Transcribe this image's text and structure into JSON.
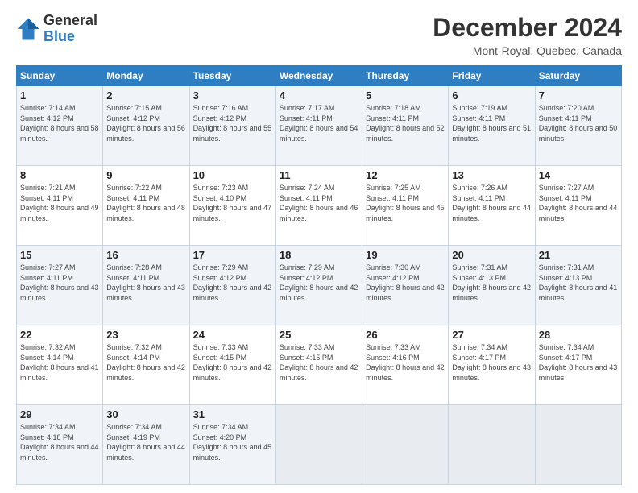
{
  "header": {
    "logo_general": "General",
    "logo_blue": "Blue",
    "month_title": "December 2024",
    "location": "Mont-Royal, Quebec, Canada"
  },
  "weekdays": [
    "Sunday",
    "Monday",
    "Tuesday",
    "Wednesday",
    "Thursday",
    "Friday",
    "Saturday"
  ],
  "weeks": [
    [
      {
        "day": "1",
        "sunrise": "7:14 AM",
        "sunset": "4:12 PM",
        "daylight": "8 hours and 58 minutes."
      },
      {
        "day": "2",
        "sunrise": "7:15 AM",
        "sunset": "4:12 PM",
        "daylight": "8 hours and 56 minutes."
      },
      {
        "day": "3",
        "sunrise": "7:16 AM",
        "sunset": "4:12 PM",
        "daylight": "8 hours and 55 minutes."
      },
      {
        "day": "4",
        "sunrise": "7:17 AM",
        "sunset": "4:11 PM",
        "daylight": "8 hours and 54 minutes."
      },
      {
        "day": "5",
        "sunrise": "7:18 AM",
        "sunset": "4:11 PM",
        "daylight": "8 hours and 52 minutes."
      },
      {
        "day": "6",
        "sunrise": "7:19 AM",
        "sunset": "4:11 PM",
        "daylight": "8 hours and 51 minutes."
      },
      {
        "day": "7",
        "sunrise": "7:20 AM",
        "sunset": "4:11 PM",
        "daylight": "8 hours and 50 minutes."
      }
    ],
    [
      {
        "day": "8",
        "sunrise": "7:21 AM",
        "sunset": "4:11 PM",
        "daylight": "8 hours and 49 minutes."
      },
      {
        "day": "9",
        "sunrise": "7:22 AM",
        "sunset": "4:11 PM",
        "daylight": "8 hours and 48 minutes."
      },
      {
        "day": "10",
        "sunrise": "7:23 AM",
        "sunset": "4:10 PM",
        "daylight": "8 hours and 47 minutes."
      },
      {
        "day": "11",
        "sunrise": "7:24 AM",
        "sunset": "4:11 PM",
        "daylight": "8 hours and 46 minutes."
      },
      {
        "day": "12",
        "sunrise": "7:25 AM",
        "sunset": "4:11 PM",
        "daylight": "8 hours and 45 minutes."
      },
      {
        "day": "13",
        "sunrise": "7:26 AM",
        "sunset": "4:11 PM",
        "daylight": "8 hours and 44 minutes."
      },
      {
        "day": "14",
        "sunrise": "7:27 AM",
        "sunset": "4:11 PM",
        "daylight": "8 hours and 44 minutes."
      }
    ],
    [
      {
        "day": "15",
        "sunrise": "7:27 AM",
        "sunset": "4:11 PM",
        "daylight": "8 hours and 43 minutes."
      },
      {
        "day": "16",
        "sunrise": "7:28 AM",
        "sunset": "4:11 PM",
        "daylight": "8 hours and 43 minutes."
      },
      {
        "day": "17",
        "sunrise": "7:29 AM",
        "sunset": "4:12 PM",
        "daylight": "8 hours and 42 minutes."
      },
      {
        "day": "18",
        "sunrise": "7:29 AM",
        "sunset": "4:12 PM",
        "daylight": "8 hours and 42 minutes."
      },
      {
        "day": "19",
        "sunrise": "7:30 AM",
        "sunset": "4:12 PM",
        "daylight": "8 hours and 42 minutes."
      },
      {
        "day": "20",
        "sunrise": "7:31 AM",
        "sunset": "4:13 PM",
        "daylight": "8 hours and 42 minutes."
      },
      {
        "day": "21",
        "sunrise": "7:31 AM",
        "sunset": "4:13 PM",
        "daylight": "8 hours and 41 minutes."
      }
    ],
    [
      {
        "day": "22",
        "sunrise": "7:32 AM",
        "sunset": "4:14 PM",
        "daylight": "8 hours and 41 minutes."
      },
      {
        "day": "23",
        "sunrise": "7:32 AM",
        "sunset": "4:14 PM",
        "daylight": "8 hours and 42 minutes."
      },
      {
        "day": "24",
        "sunrise": "7:33 AM",
        "sunset": "4:15 PM",
        "daylight": "8 hours and 42 minutes."
      },
      {
        "day": "25",
        "sunrise": "7:33 AM",
        "sunset": "4:15 PM",
        "daylight": "8 hours and 42 minutes."
      },
      {
        "day": "26",
        "sunrise": "7:33 AM",
        "sunset": "4:16 PM",
        "daylight": "8 hours and 42 minutes."
      },
      {
        "day": "27",
        "sunrise": "7:34 AM",
        "sunset": "4:17 PM",
        "daylight": "8 hours and 43 minutes."
      },
      {
        "day": "28",
        "sunrise": "7:34 AM",
        "sunset": "4:17 PM",
        "daylight": "8 hours and 43 minutes."
      }
    ],
    [
      {
        "day": "29",
        "sunrise": "7:34 AM",
        "sunset": "4:18 PM",
        "daylight": "8 hours and 44 minutes."
      },
      {
        "day": "30",
        "sunrise": "7:34 AM",
        "sunset": "4:19 PM",
        "daylight": "8 hours and 44 minutes."
      },
      {
        "day": "31",
        "sunrise": "7:34 AM",
        "sunset": "4:20 PM",
        "daylight": "8 hours and 45 minutes."
      },
      null,
      null,
      null,
      null
    ]
  ]
}
